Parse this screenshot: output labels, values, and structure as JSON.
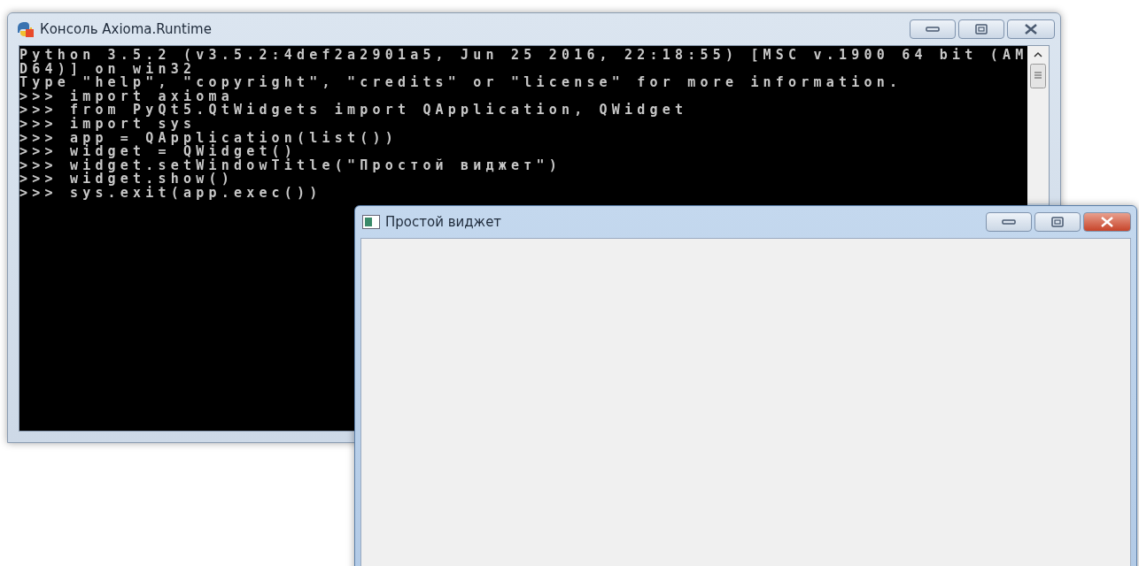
{
  "console_window": {
    "title": "Консоль Axioma.Runtime",
    "active": false,
    "lines": [
      "Python 3.5.2 (v3.5.2:4def2a2901a5, Jun 25 2016, 22:18:55) [MSC v.1900 64 bit (AM",
      "D64)] on win32",
      "Type \"help\", \"copyright\", \"credits\" or \"license\" for more information.",
      ">>> import axioma",
      ">>> from PyQt5.QtWidgets import QApplication, QWidget",
      ">>> import sys",
      ">>> app = QApplication(list())",
      ">>> widget = QWidget()",
      ">>> widget.setWindowTitle(\"Простой виджет\")",
      ">>> widget.show()",
      ">>> sys.exit(app.exec())"
    ]
  },
  "widget_window": {
    "title": "Простой виджет",
    "active": true
  }
}
